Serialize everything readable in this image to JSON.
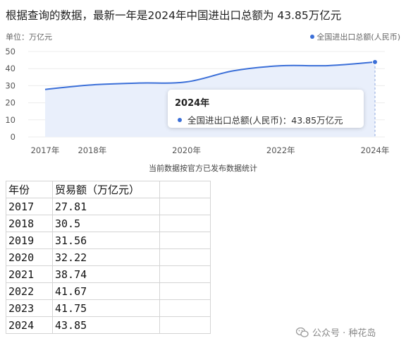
{
  "headline": "根据查询的数据，最新一年是2024年中国进出口总额为 43.85万亿元",
  "unit_label": "单位：万亿元",
  "legend_label": "全国进出口总额(人民币)",
  "footnote": "当前数据按官方已发布数据统计",
  "tooltip": {
    "title": "2024年",
    "series_label": "全国进出口总额(人民币)：43.85万亿元"
  },
  "colors": {
    "line": "#3b6fd8",
    "area": "#e9effb",
    "grid": "#ececec"
  },
  "chart_data": {
    "type": "area",
    "x": [
      2017,
      2018,
      2019,
      2020,
      2021,
      2022,
      2023,
      2024
    ],
    "series": [
      {
        "name": "全国进出口总额(人民币)",
        "values": [
          27.81,
          30.5,
          31.56,
          32.22,
          38.74,
          41.67,
          41.75,
          43.85
        ]
      }
    ],
    "yticks": [
      "0",
      "10",
      "20",
      "30",
      "40",
      "50"
    ],
    "ylim": [
      0,
      50
    ],
    "xticks": [
      {
        "label": "2017年",
        "x": 2017
      },
      {
        "label": "2018年",
        "x": 2018
      },
      {
        "label": "2020年",
        "x": 2020
      },
      {
        "label": "2022年",
        "x": 2022
      },
      {
        "label": "2024年",
        "x": 2024
      }
    ],
    "highlight_index": 7,
    "grid": true,
    "legend_position": "top-right"
  },
  "table": {
    "headers": [
      "年份",
      "贸易额（万亿元）",
      ""
    ],
    "rows": [
      [
        "2017",
        "27.81",
        ""
      ],
      [
        "2018",
        "30.5",
        ""
      ],
      [
        "2019",
        "31.56",
        ""
      ],
      [
        "2020",
        "32.22",
        ""
      ],
      [
        "2021",
        "38.74",
        ""
      ],
      [
        "2022",
        "41.67",
        ""
      ],
      [
        "2023",
        "41.75",
        ""
      ],
      [
        "2024",
        "43.85",
        ""
      ]
    ]
  },
  "watermark": "公众号 · 种花岛",
  "watermark_icon": "wechat-icon"
}
